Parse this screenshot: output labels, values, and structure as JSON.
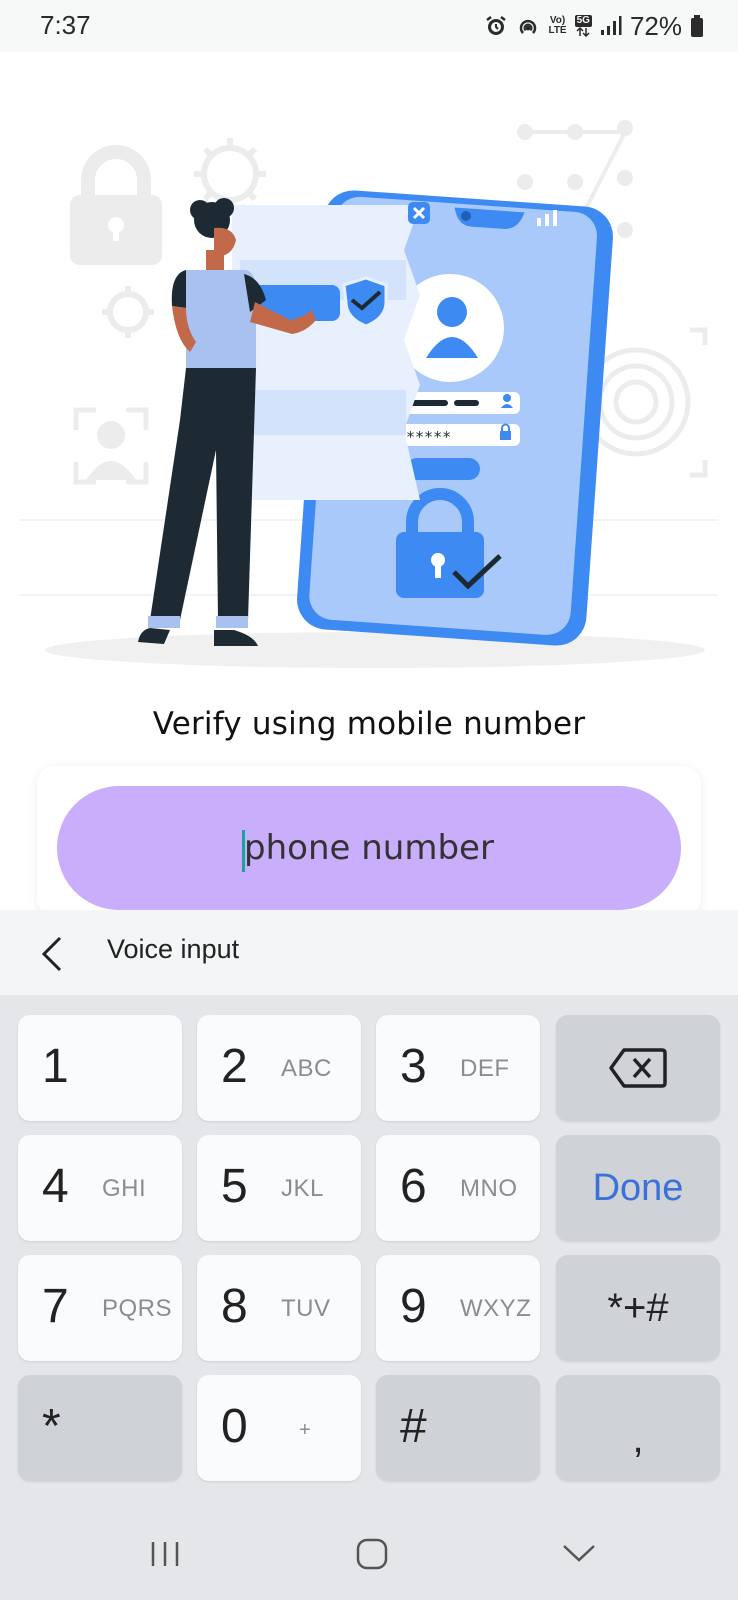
{
  "status_bar": {
    "time": "7:37",
    "network_top": "Vo)",
    "network_bottom": "LTE",
    "network_5g": "5G",
    "battery": "72%",
    "icons": [
      "alarm-icon",
      "hotspot-icon",
      "volte-icon",
      "5g-icon",
      "signal-icon",
      "battery-icon"
    ]
  },
  "main": {
    "title": "Verify using mobile number",
    "phone_input": {
      "placeholder": "phone number",
      "value": ""
    }
  },
  "keyboard_toolbar": {
    "voice_input_label": "Voice input"
  },
  "keyboard": {
    "keys": [
      {
        "num": "1",
        "letters": ""
      },
      {
        "num": "2",
        "letters": "ABC"
      },
      {
        "num": "3",
        "letters": "DEF"
      },
      {
        "num": "4",
        "letters": "GHI"
      },
      {
        "num": "5",
        "letters": "JKL"
      },
      {
        "num": "6",
        "letters": "MNO"
      },
      {
        "num": "7",
        "letters": "PQRS"
      },
      {
        "num": "8",
        "letters": "TUV"
      },
      {
        "num": "9",
        "letters": "WXYZ"
      },
      {
        "num": "0",
        "letters": "+"
      }
    ],
    "done_label": "Done",
    "symbols_label": "*+#",
    "star_label": "*",
    "hash_label": "#",
    "comma_label": ","
  },
  "colors": {
    "accent_input": "#c9aefc",
    "done_blue": "#3b72d9",
    "illustration_blue": "#3d8bf2"
  }
}
